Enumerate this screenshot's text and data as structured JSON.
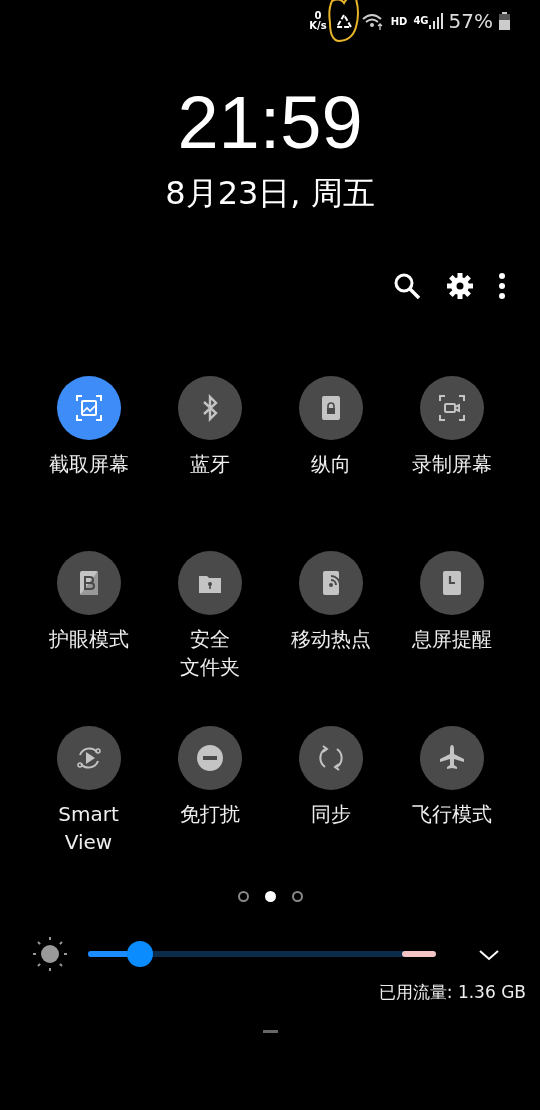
{
  "status_bar": {
    "speed_value": "0",
    "speed_unit": "K/s",
    "network_label": "HD",
    "signal_label": "4G",
    "battery": "57%"
  },
  "clock": {
    "time": "21:59",
    "date": "8月23日, 周五"
  },
  "tiles": [
    {
      "label_lines": [
        "截取屏幕"
      ],
      "selected": true
    },
    {
      "label_lines": [
        "蓝牙"
      ],
      "selected": false
    },
    {
      "label_lines": [
        "纵向"
      ],
      "selected": false
    },
    {
      "label_lines": [
        "录制屏幕"
      ],
      "selected": false
    },
    {
      "label_lines": [
        "护眼模式"
      ],
      "selected": false
    },
    {
      "label_lines": [
        "安全",
        "文件夹"
      ],
      "selected": false
    },
    {
      "label_lines": [
        "移动热点"
      ],
      "selected": false
    },
    {
      "label_lines": [
        "息屏提醒"
      ],
      "selected": false
    },
    {
      "label_lines": [
        "Smart",
        "View"
      ],
      "selected": false
    },
    {
      "label_lines": [
        "免打扰"
      ],
      "selected": false
    },
    {
      "label_lines": [
        "同步"
      ],
      "selected": false
    },
    {
      "label_lines": [
        "飞行模式"
      ],
      "selected": false
    }
  ],
  "pages": [
    {
      "selected": false
    },
    {
      "selected": true
    },
    {
      "selected": false
    }
  ],
  "brightness": {
    "level": 0.15
  },
  "data_usage": "已用流量: 1.36 GB"
}
